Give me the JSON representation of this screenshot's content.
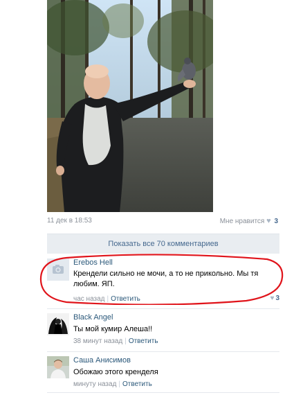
{
  "post": {
    "photo_icon": "photo",
    "date": "11 дек в 18:53",
    "like_label": "Мне нравится",
    "like_icon": "heart-icon",
    "like_count": "3"
  },
  "show_all_comments": "Показать все 70 комментариев",
  "comments": [
    {
      "author": "Erebos Hell",
      "avatar_icon": "camera-icon",
      "text": "Крендели сильно не мочи, а то не прикольно. Мы тя любим. ЯП.",
      "time": "час назад",
      "reply_label": "Ответить",
      "like_count": "3",
      "highlight_color": "#e0141b"
    },
    {
      "author": "Black Angel",
      "avatar_icon": "angel-avatar",
      "text": "Ты мой кумир Алеша!!",
      "time": "38 минут назад",
      "reply_label": "Ответить"
    },
    {
      "author": "Саша Анисимов",
      "avatar_icon": "person-avatar",
      "text": "Обожаю этого кренделя",
      "time": "минуту назад",
      "reply_label": "Ответить"
    }
  ],
  "colors": {
    "link": "#2b587a",
    "muted": "#8a9099",
    "show_all_bg": "#e9edf1",
    "highlight": "#e0141b"
  }
}
